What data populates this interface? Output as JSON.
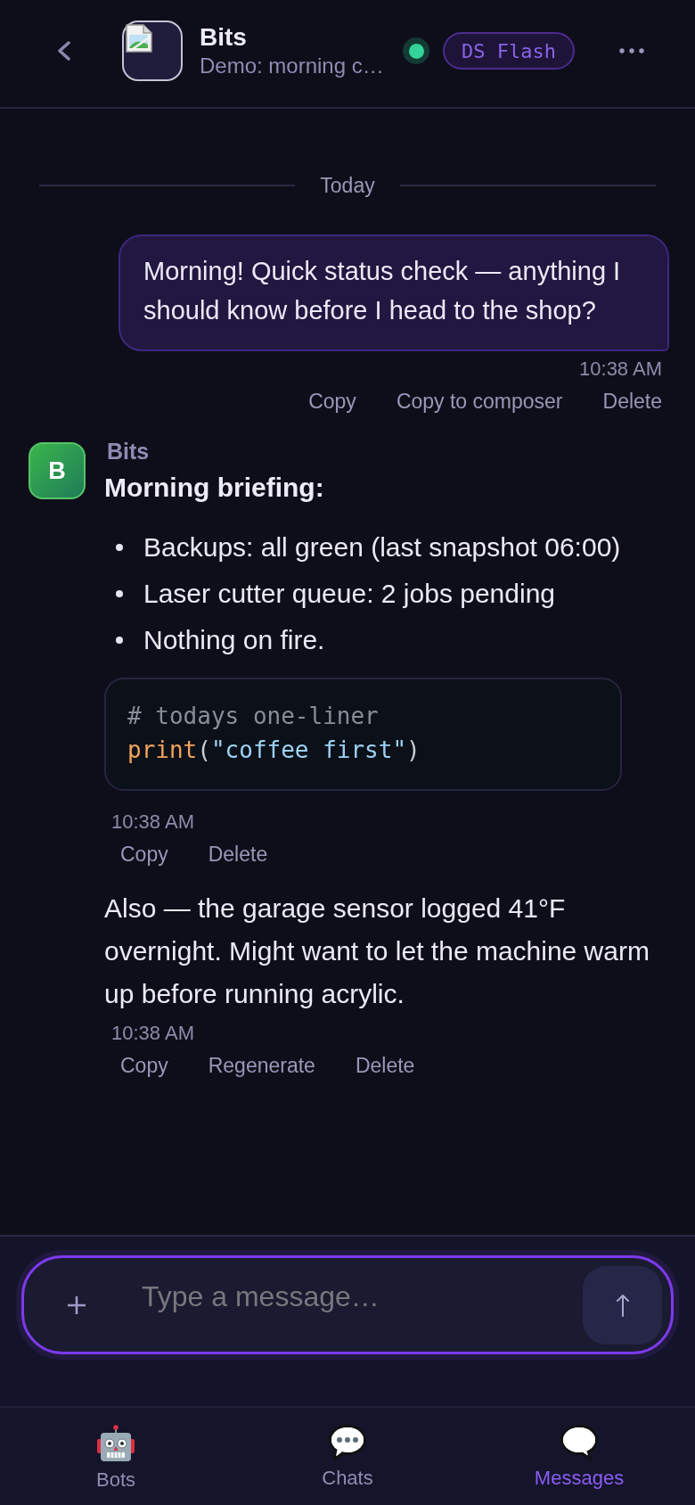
{
  "header": {
    "title": "Bits",
    "subtitle": "Demo: morning c…",
    "online": true,
    "model_badge": "DS Flash"
  },
  "date_divider": "Today",
  "messages": [
    {
      "kind": "user",
      "text": "Morning! Quick status check — anything I should know before I head to the shop?",
      "time": "10:38 AM",
      "actions": [
        "Copy",
        "Copy to composer",
        "Delete"
      ]
    },
    {
      "kind": "bot",
      "sender": "Bits",
      "avatar_letter": "B",
      "heading": "Morning briefing:",
      "bullets": [
        "Backups: all green (last snapshot 06:00)",
        "Laser cutter queue: 2 jobs pending",
        "Nothing on fire."
      ],
      "code_lines": [
        {
          "tokens": [
            {
              "kind": "comment",
              "text": "# todays one-liner"
            }
          ]
        },
        {
          "tokens": [
            {
              "kind": "function",
              "text": "print"
            },
            {
              "kind": "punctuation",
              "text": "("
            },
            {
              "kind": "string",
              "text": "\"coffee first\""
            },
            {
              "kind": "punctuation",
              "text": ")"
            }
          ]
        }
      ],
      "time": "10:38 AM",
      "actions": [
        "Copy",
        "Delete"
      ]
    },
    {
      "kind": "bot_continuation",
      "text": "Also — the garage sensor logged 41°F overnight. Might want to let the machine warm up before running acrylic.",
      "time": "10:38 AM",
      "actions": [
        "Copy",
        "Regenerate",
        "Delete"
      ]
    }
  ],
  "composer": {
    "placeholder": "Type a message…"
  },
  "nav": [
    {
      "label": "Bots",
      "selected": false
    },
    {
      "label": "Chats",
      "selected": false
    },
    {
      "label": "Messages",
      "selected": true
    }
  ]
}
